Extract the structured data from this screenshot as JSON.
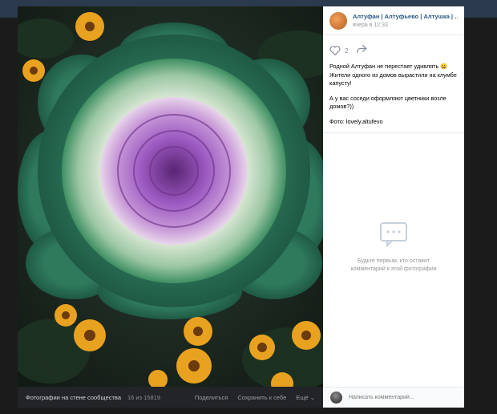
{
  "post": {
    "author": "Алтуфан | Алтуфьево | Алтушка | С...",
    "time": "вчера в 12:33",
    "likes": "2",
    "text": [
      "Родной Алтуфан не перестает удивлять 😀 Жители одного из домов вырастили на клумбе капусту!",
      "А у вас соседи оформляют цветники возле домов?))",
      "Фото: lovely.altufevo"
    ]
  },
  "empty_comments": "Будьте первым, кто оставит комментарий к этой фотографии",
  "comment": {
    "placeholder": "Написать комментарий..."
  },
  "bottombar": {
    "album": "Фотографии на стене сообщества",
    "counter": "16 из 15819",
    "share": "Поделиться",
    "save": "Сохранить к себе",
    "more": "Ещё ⌄"
  },
  "icons": {
    "like": "heart-icon",
    "share": "share-arrow-icon",
    "comments": "comment-bubble-icon"
  },
  "colors": {
    "link": "#2a5885",
    "muted": "#939699",
    "photo_purple": "#9c5bc2",
    "photo_green": "#2f7a5d",
    "marigold": "#e9a21f"
  }
}
